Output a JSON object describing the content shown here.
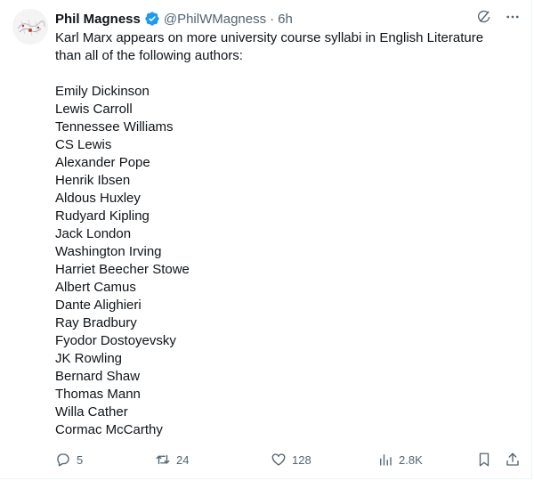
{
  "tweet": {
    "author_name": "Phil Magness",
    "handle": "@PhilWMagness",
    "separator": "·",
    "time": "6h",
    "intro": "Karl Marx appears on more university course syllabi in English Literature than all of the following authors:",
    "authors": [
      "Emily Dickinson",
      "Lewis Carroll",
      "Tennessee Williams",
      "CS Lewis",
      "Alexander Pope",
      "Henrik Ibsen",
      "Aldous Huxley",
      "Rudyard Kipling",
      "Jack London",
      "Washington Irving",
      "Harriet Beecher Stowe",
      "Albert Camus",
      "Dante Alighieri",
      "Ray Bradbury",
      "Fyodor Dostoyevsky",
      "JK Rowling",
      "Bernard Shaw",
      "Thomas Mann",
      "Willa Cather",
      "Cormac McCarthy"
    ],
    "stats": {
      "replies": "5",
      "reposts": "24",
      "likes": "128",
      "views": "2.8K"
    }
  },
  "icons": {
    "verified": "verified-badge-icon",
    "grok": "grok-icon",
    "more": "more-icon",
    "reply": "reply-icon",
    "repost": "repost-icon",
    "like": "heart-icon",
    "views": "views-icon",
    "bookmark": "bookmark-icon",
    "share": "share-icon"
  },
  "colors": {
    "text": "#0f1419",
    "secondary": "#536471",
    "verified": "#1d9bf0"
  }
}
